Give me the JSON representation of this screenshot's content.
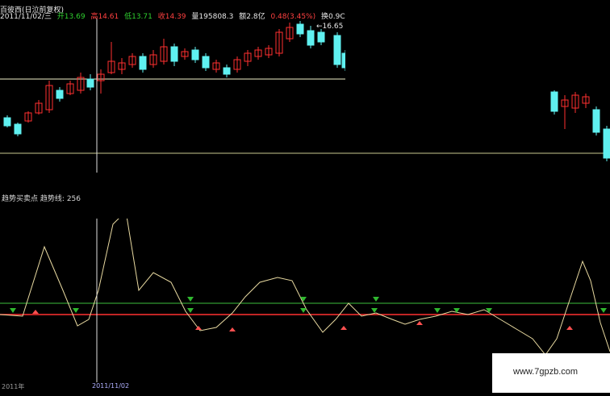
{
  "header": {
    "name": "百彼西(日泣前复权)",
    "date": "2011/11/02/三",
    "open_label": "开",
    "open_value": "13.69",
    "high_label": "高",
    "high_value": "14.61",
    "low_label": "低",
    "low_value": "13.71",
    "close_label": "收",
    "close_value": "14.39",
    "volume_label": "量",
    "volume_value": "195808.3",
    "amount_label": "额",
    "amount_value": "2.8亿",
    "change_value": "0.48(3.45%)",
    "turnover_label": "换",
    "turnover_value": "0.9C(8"
  },
  "price_annotation": "16.65",
  "indicator": {
    "title": "趋势买卖点",
    "line_label": "趋势线:",
    "line_value": "256"
  },
  "footer": {
    "left_date": "2011年",
    "crosshair_date": "2011/11/02"
  },
  "watermark": "www.7gpzb.com",
  "colors": {
    "up": "#ff3030",
    "down": "#5ff0f0",
    "reference_line": "#f0f0c8",
    "indicator_line": "#e8d9a0",
    "upper_band": "#3cbf3c",
    "lower_band": "#ff3030",
    "marker_green": "#2fb82f",
    "marker_red": "#ff5050"
  },
  "icons": {
    "buy_marker": "red-up-arrow",
    "sell_marker": "green-down-arrow"
  }
}
